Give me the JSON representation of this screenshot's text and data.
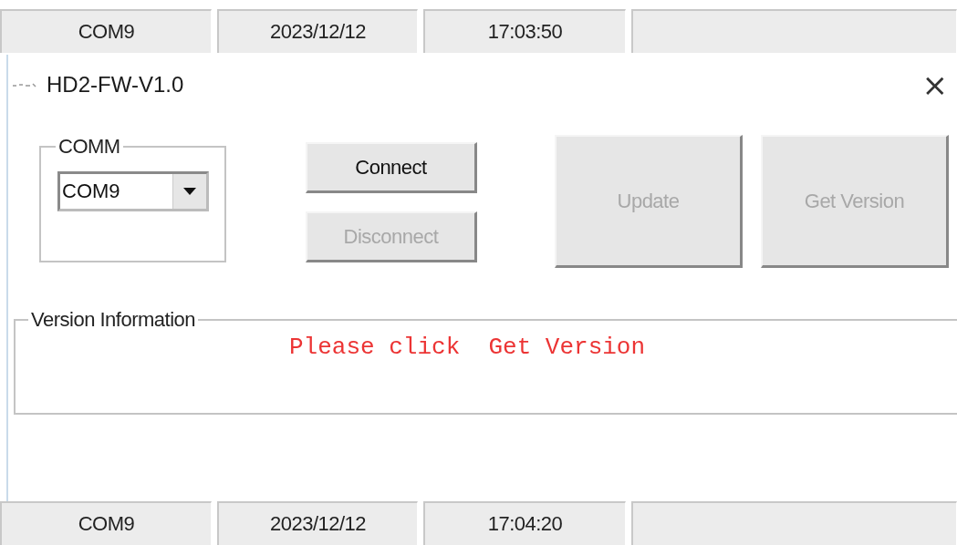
{
  "top_status_bar": {
    "fields": [
      "COM9",
      "2023/12/12",
      "17:03:50"
    ]
  },
  "window": {
    "title": "HD2-FW-V1.0",
    "close": "×"
  },
  "comm_group": {
    "label": "COMM",
    "port": {
      "value": "COM9"
    }
  },
  "buttons": [
    {
      "label": "Connect",
      "disabled": false
    },
    {
      "label": "Disconnect",
      "disabled": true
    },
    {
      "label": "Update",
      "disabled": true
    },
    {
      "label": "Get Version",
      "disabled": true
    }
  ],
  "version_group": {
    "label": "Version Information",
    "message": "Please click  Get Version"
  },
  "bottom_status_bar": {
    "fields": [
      "COM9",
      "2023/12/12",
      "17:04:20"
    ]
  }
}
